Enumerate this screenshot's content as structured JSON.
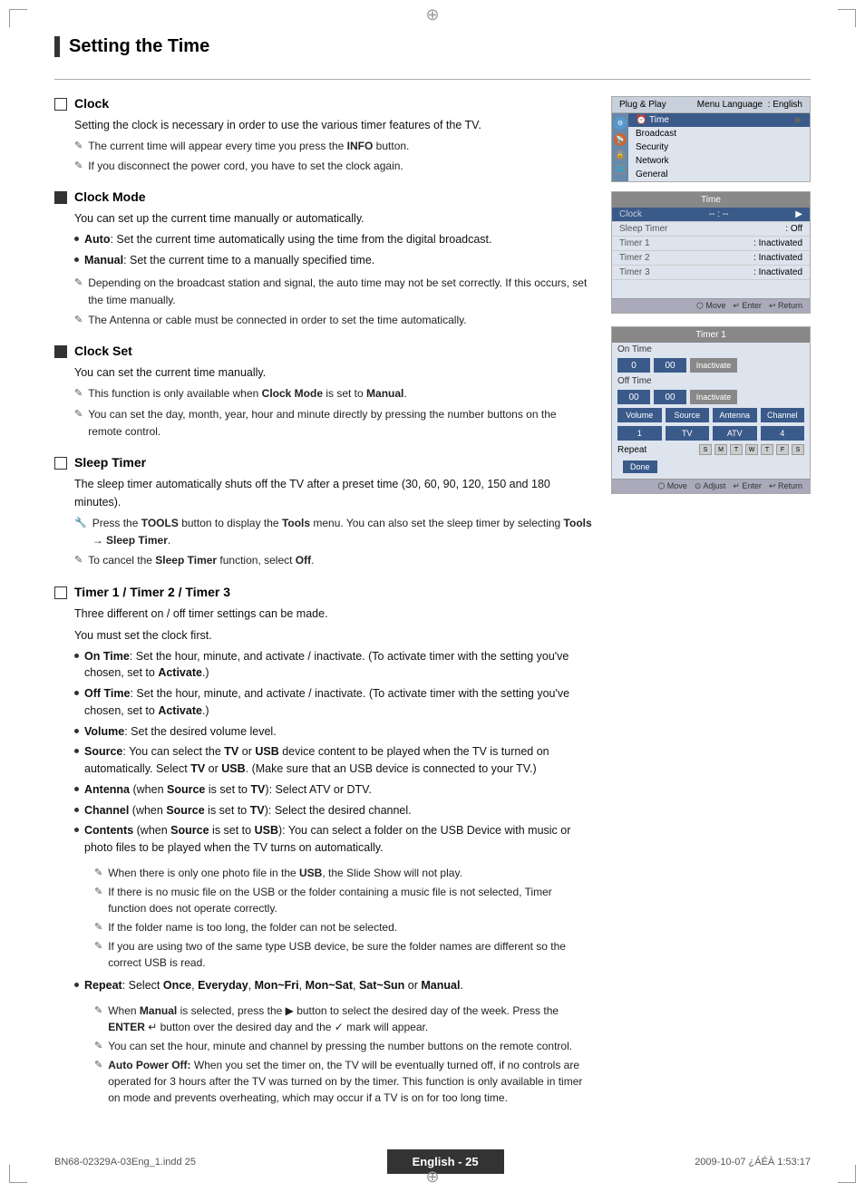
{
  "page": {
    "title": "Setting the Time",
    "footer_text": "English - 25",
    "footer_file": "BN68-02329A-03Eng_1.indd   25",
    "footer_date": "2009-10-07   ¿ÁÉÀ 1:53:17"
  },
  "sections": {
    "clock": {
      "title": "Clock",
      "type": "checkbox_open",
      "intro": "Setting the clock is necessary in order to use the various timer features of the TV.",
      "notes": [
        "The current time will appear every time you press the INFO button.",
        "If you disconnect the power cord, you have to set the clock again."
      ]
    },
    "clock_mode": {
      "title": "Clock Mode",
      "type": "square",
      "intro": "You can set up the current time manually or automatically.",
      "bullets": [
        {
          "label": "Auto",
          "text": ": Set the current time automatically using the time from the digital broadcast."
        },
        {
          "label": "Manual",
          "text": ": Set the current time to a manually specified time."
        }
      ],
      "notes": [
        "Depending on the broadcast station and signal, the auto time may not be set correctly. If this occurs, set the time manually.",
        "The Antenna or cable must be connected in order to set the time automatically."
      ]
    },
    "clock_set": {
      "title": "Clock Set",
      "type": "square",
      "intro": "You can set the current time manually.",
      "notes": [
        "This function is only available when Clock Mode is set to Manual.",
        "You can set the day, month, year, hour and minute directly by pressing the number buttons on the remote control."
      ]
    },
    "sleep_timer": {
      "title": "Sleep Timer",
      "type": "checkbox_open",
      "intro": "The sleep timer automatically shuts off the TV after a preset time (30, 60, 90, 120, 150 and 180 minutes).",
      "notes_tools": [
        "Press the TOOLS button to display the Tools menu. You can also set the sleep timer by selecting Tools → Sleep Timer.",
        "To cancel the Sleep Timer function, select Off."
      ]
    },
    "timer": {
      "title": "Timer 1 / Timer 2 / Timer 3",
      "type": "checkbox_open",
      "intro1": "Three different on / off timer settings can be made.",
      "intro2": "You must set the clock first.",
      "bullets": [
        {
          "label": "On Time",
          "text": ": Set the hour, minute, and activate / inactivate. (To activate timer with the setting you've chosen, set to Activate.)"
        },
        {
          "label": "Off Time",
          "text": ": Set the hour, minute, and activate / inactivate. (To activate timer with the setting you've chosen, set to Activate.)"
        },
        {
          "label": "Volume",
          "text": ": Set the desired volume level."
        },
        {
          "label": "Source",
          "text": ": You can select the TV or USB device content to be played when the TV is turned on automatically. Select TV or USB. (Make sure that an USB device is connected to your TV.)"
        },
        {
          "label": "Antenna",
          "text": " (when Source is set to TV): Select ATV or DTV."
        },
        {
          "label": "Channel",
          "text": " (when Source is set to TV): Select the desired channel."
        },
        {
          "label": "Contents",
          "text": " (when Source is set to USB): You can select a folder on the USB Device with music or photo files to be played when the TV turns on automatically.",
          "sub_notes": [
            "When there is only one photo file in the USB, the Slide Show will not play.",
            "If there is no music file on the USB or the folder containing a music file is not selected, Timer function does not operate correctly.",
            "If the folder name is too long, the folder can not be selected.",
            "If you are using two of the same type USB device, be sure the folder names are different so the correct USB is read."
          ]
        },
        {
          "label": "Repeat",
          "text": ": Select Once, Everyday, Mon~Fri, Mon~Sat, Sat~Sun or Manual.",
          "sub_notes": [
            "When Manual is selected, press the ▶ button to select the desired day of the week. Press the ENTER ↵ button over the desired day and the ✓ mark will appear.",
            "You can set the hour, minute and channel by pressing the number buttons on the remote control.",
            "Auto Power Off: When you set the timer on, the TV will be eventually turned off, if no controls are operated for 3 hours after the TV was turned on by the timer. This function is only available in timer on mode and prevents overheating, which may occur if a TV is on for too long time."
          ]
        }
      ]
    }
  },
  "panels": {
    "menu_panel": {
      "title": "Plug & Play",
      "menu_language_label": "Menu Language",
      "menu_language_value": ": English",
      "time_label": "Time",
      "items": [
        "Broadcast",
        "Security",
        "Network",
        "General"
      ]
    },
    "time_panel": {
      "title": "Time",
      "rows": [
        {
          "label": "Clock",
          "value": "-- : --",
          "highlighted": true
        },
        {
          "label": "Sleep Timer",
          "value": ": Off"
        },
        {
          "label": "Timer 1",
          "value": ": Inactivated"
        },
        {
          "label": "Timer 2",
          "value": ": Inactivated"
        },
        {
          "label": "Timer 3",
          "value": ": Inactivated"
        }
      ],
      "nav": "Move  Enter  Return"
    },
    "timer1_panel": {
      "title": "Timer 1",
      "on_time_label": "On Time",
      "on_values": [
        "0",
        "00",
        "Inactivate"
      ],
      "off_time_label": "Off Time",
      "off_values": [
        "00",
        "00",
        "Inactivate"
      ],
      "source_labels": [
        "Volume",
        "Source",
        "Antenna",
        "Channel"
      ],
      "source_values": [
        "1",
        "TV",
        "ATV",
        "4"
      ],
      "repeat_label": "Repeat",
      "days": [
        "Sun",
        "Mon",
        "Tue",
        "Wed",
        "Thu",
        "Fri",
        "Sat"
      ],
      "done_label": "Done",
      "nav": "Move  Adjust  Enter  Return"
    }
  },
  "icons": {
    "pencil": "✎",
    "tools": "🔧",
    "checkbox_open": "□",
    "checkbox_filled": "■",
    "arrow_right": "▶",
    "cross": "⊕"
  }
}
